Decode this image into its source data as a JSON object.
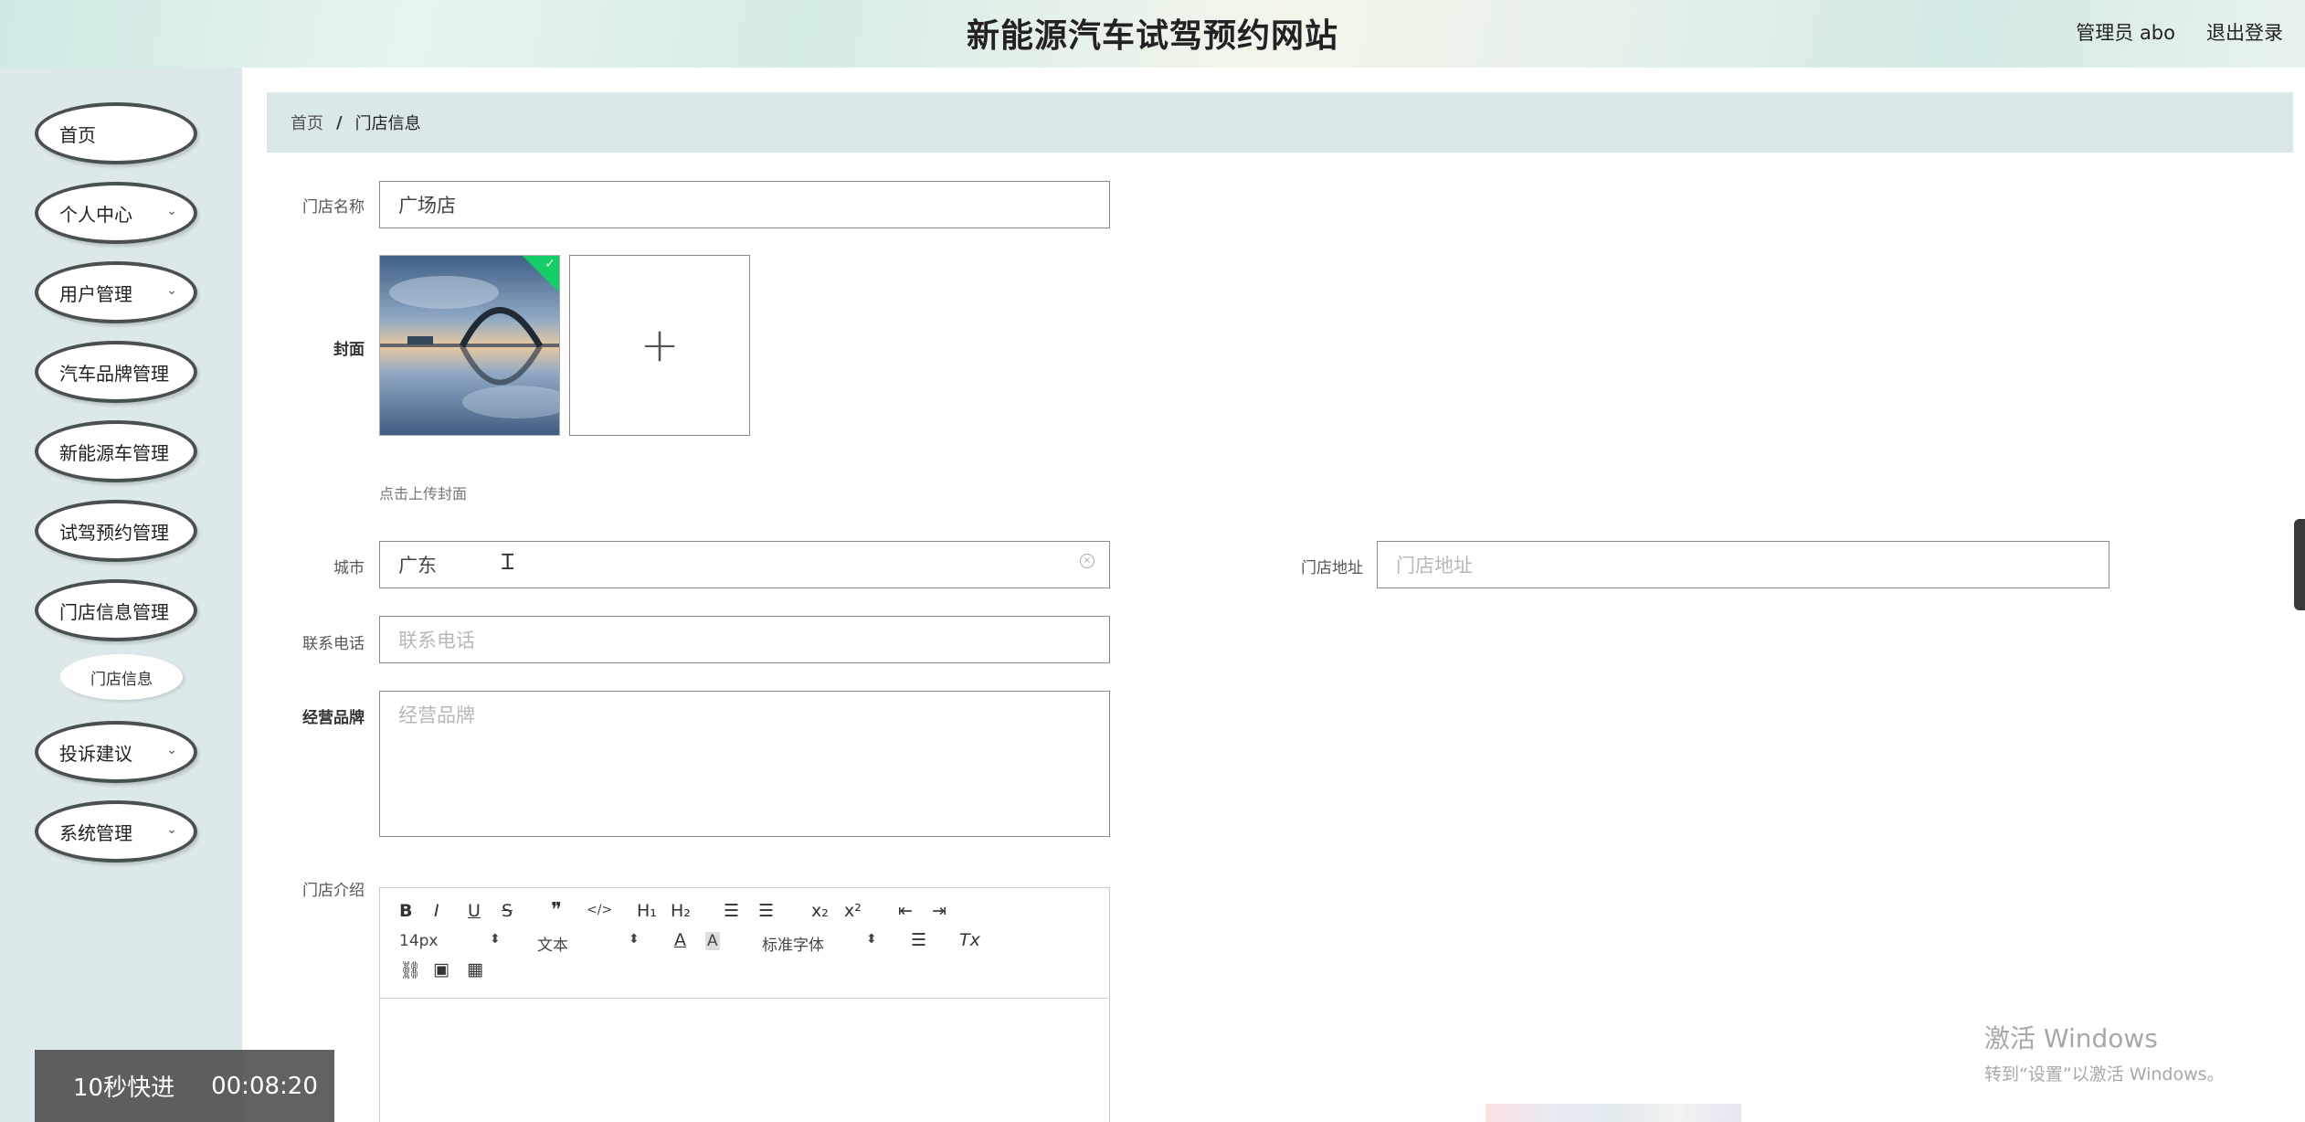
{
  "header": {
    "site_title": "新能源汽车试驾预约网站",
    "user": "管理员 abo",
    "logout": "退出登录"
  },
  "sidebar": {
    "items": [
      {
        "label": "首页",
        "has_children": false
      },
      {
        "label": "个人中心",
        "has_children": true
      },
      {
        "label": "用户管理",
        "has_children": true
      },
      {
        "label": "汽车品牌管理",
        "has_children": false
      },
      {
        "label": "新能源车管理",
        "has_children": false
      },
      {
        "label": "试驾预约管理",
        "has_children": false
      },
      {
        "label": "门店信息管理",
        "has_children": false
      },
      {
        "label": "投诉建议",
        "has_children": true
      },
      {
        "label": "系统管理",
        "has_children": true
      }
    ],
    "sub_item": "门店信息"
  },
  "breadcrumb": {
    "home": "首页",
    "separator": "/",
    "current": "门店信息"
  },
  "form": {
    "store_name_label": "门店名称",
    "store_name_value": "广场店",
    "cover_label": "封面",
    "upload_plus": "+",
    "upload_hint": "点击上传封面",
    "city_label": "城市",
    "city_value": "广东",
    "address_label": "门店地址",
    "address_placeholder": "门店地址",
    "phone_label": "联系电话",
    "phone_placeholder": "联系电话",
    "brand_label": "经营品牌",
    "brand_placeholder": "经营品牌",
    "intro_label": "门店介绍"
  },
  "editor": {
    "bold": "B",
    "italic": "I",
    "underline": "U",
    "strike": "S",
    "quote": "❞",
    "code": "</>",
    "h1": "H₁",
    "h2": "H₂",
    "ordered_list": "☰",
    "bullet_list": "☰",
    "subscript": "x₂",
    "superscript": "x²",
    "outdent": "⇤",
    "indent": "⇥",
    "font_size": "14px",
    "text_style": "文本",
    "font_family": "标准字体",
    "color": "A",
    "background": "A",
    "align": "☰",
    "clean": "Tx",
    "link": "⛓",
    "image": "▣",
    "video": "▦",
    "select_arrow": "⬍"
  },
  "video_overlay": {
    "label": "10秒快进",
    "time": "00:08:20"
  },
  "watermark": {
    "line1": "激活 Windows",
    "line2": "转到“设置”以激活 Windows。"
  }
}
